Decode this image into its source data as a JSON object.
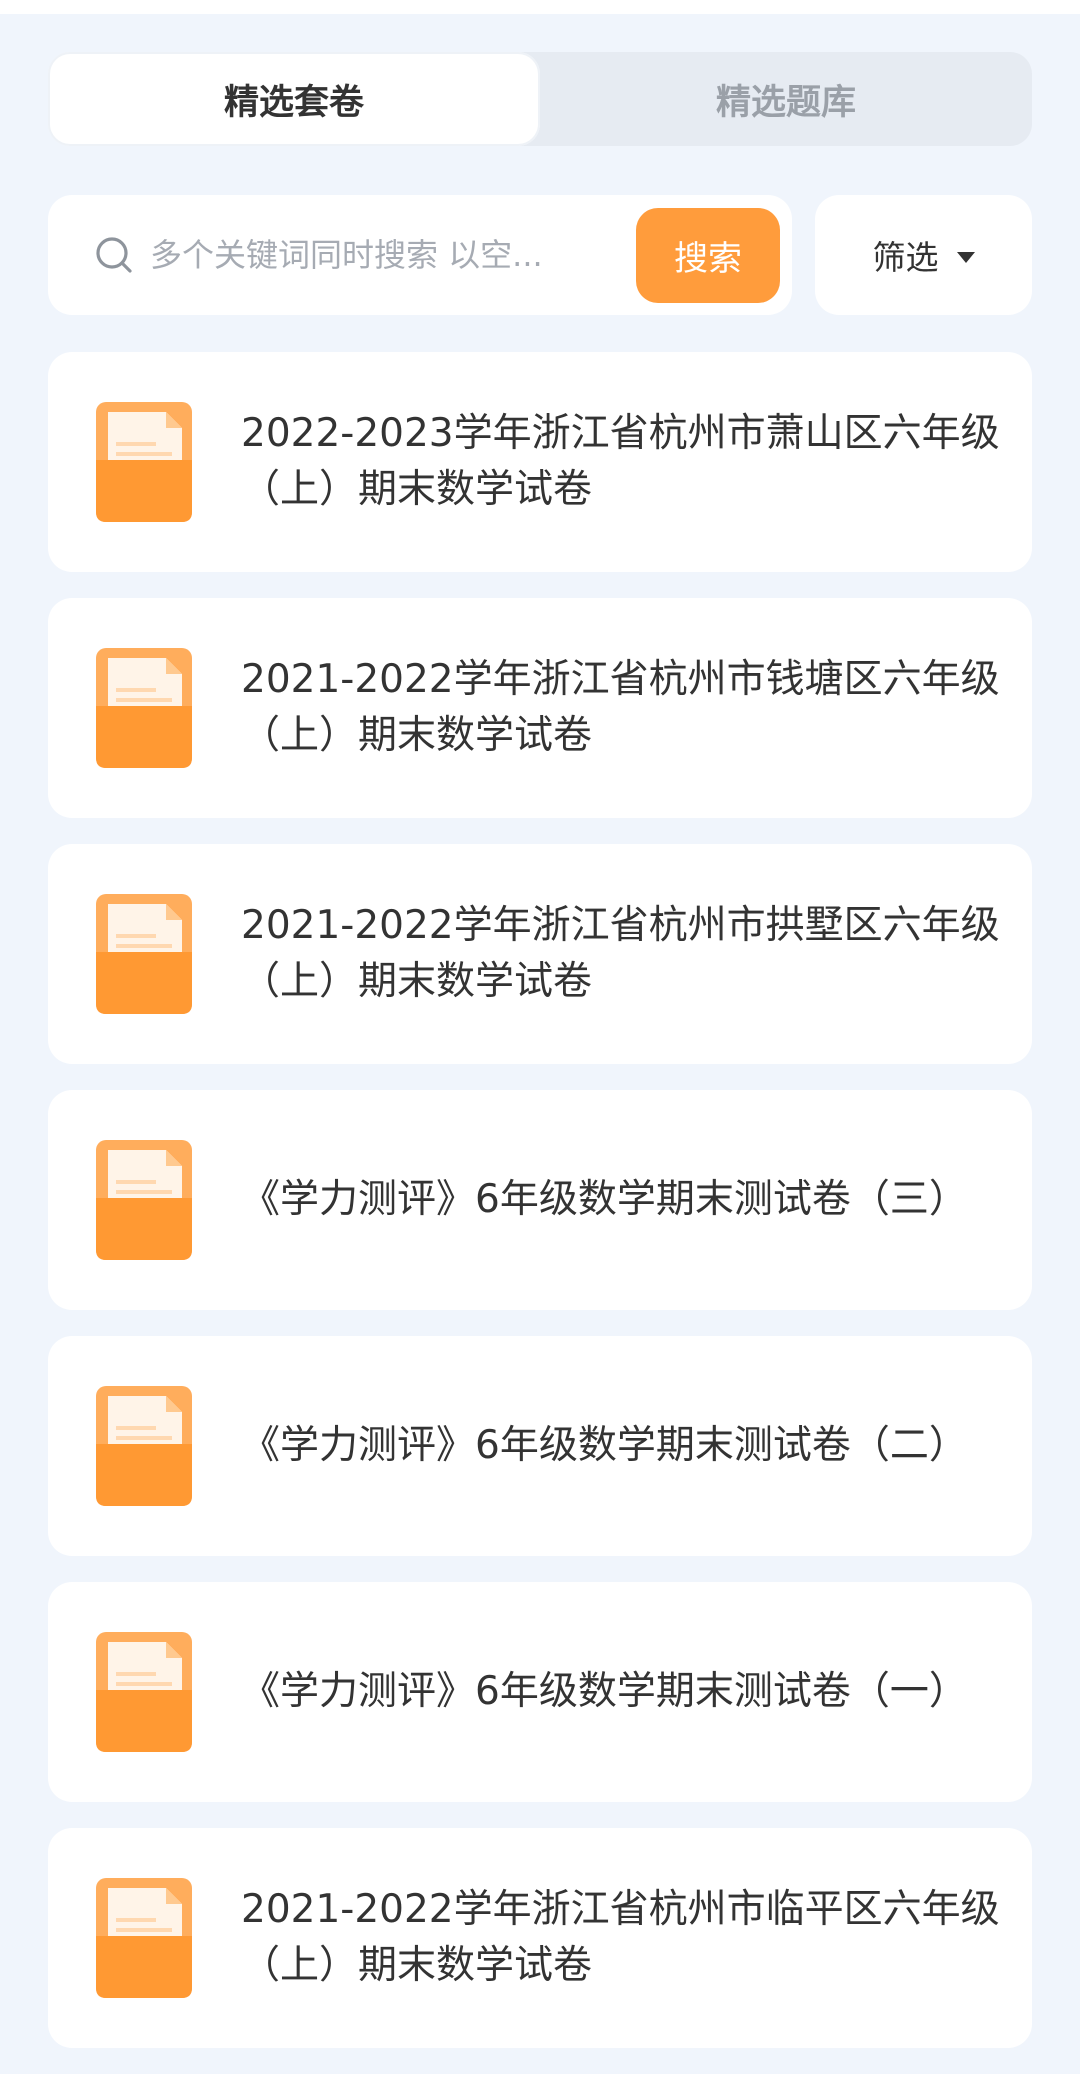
{
  "tabs": [
    {
      "label": "精选套卷",
      "active": true
    },
    {
      "label": "精选题库",
      "active": false
    }
  ],
  "search": {
    "placeholder": "多个关键词同时搜索 以空...",
    "button_label": "搜索",
    "icon": "search-icon"
  },
  "filter": {
    "label": "筛选",
    "icon": "caret-down-icon"
  },
  "papers": [
    {
      "title": "2022-2023学年浙江省杭州市萧山区六年级（上）期末数学试卷",
      "icon": "document-icon"
    },
    {
      "title": "2021-2022学年浙江省杭州市钱塘区六年级（上）期末数学试卷",
      "icon": "document-icon"
    },
    {
      "title": "2021-2022学年浙江省杭州市拱墅区六年级（上）期末数学试卷",
      "icon": "document-icon"
    },
    {
      "title": "《学力测评》6年级数学期末测试卷（三）",
      "icon": "document-icon"
    },
    {
      "title": "《学力测评》6年级数学期末测试卷（二）",
      "icon": "document-icon"
    },
    {
      "title": "《学力测评》6年级数学期末测试卷（一）",
      "icon": "document-icon"
    },
    {
      "title": "2021-2022学年浙江省杭州市临平区六年级（上）期末数学试卷",
      "icon": "document-icon"
    }
  ],
  "colors": {
    "accent": "#ff9c3c",
    "background": "#f0f5fc",
    "card": "#ffffff",
    "text": "#333333",
    "muted": "#9aa0a8"
  }
}
